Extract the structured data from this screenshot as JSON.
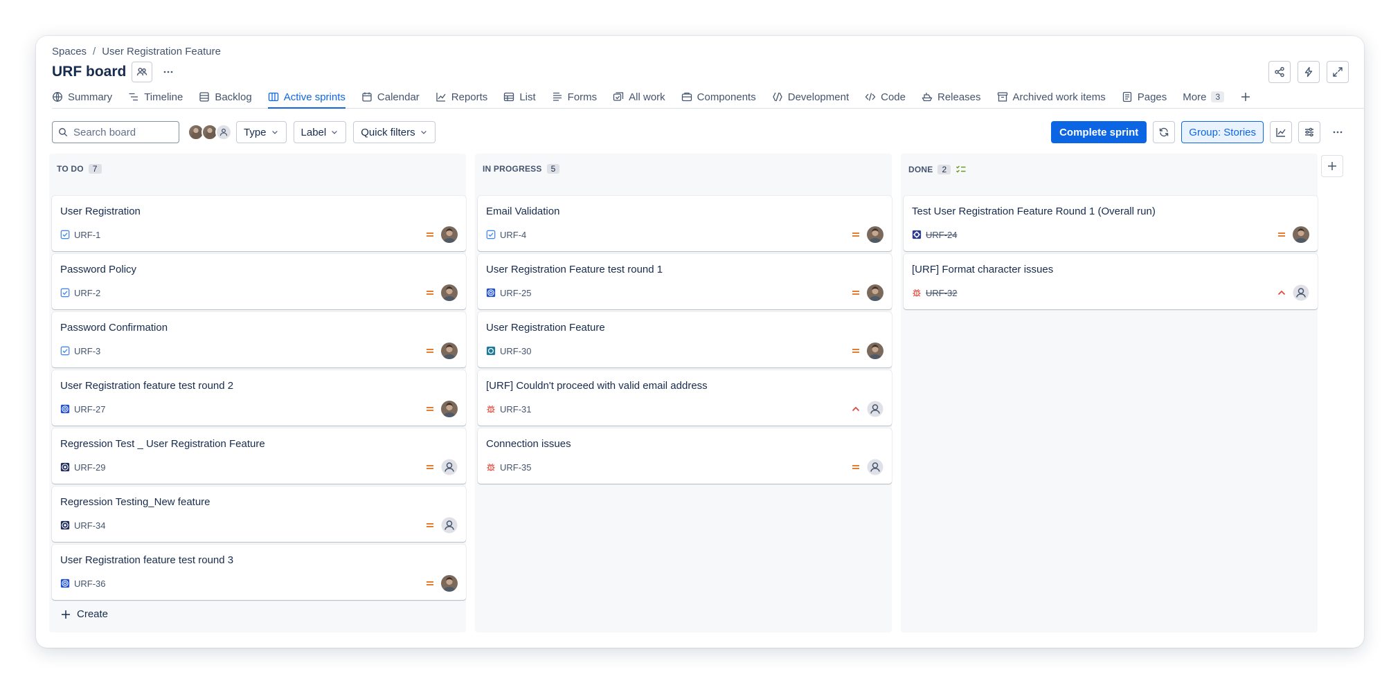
{
  "breadcrumb": {
    "root": "Spaces",
    "separator": "/",
    "project": "User Registration Feature"
  },
  "board": {
    "title": "URF board"
  },
  "tabs": [
    {
      "label": "Summary",
      "icon": "globe-icon"
    },
    {
      "label": "Timeline",
      "icon": "timeline-icon"
    },
    {
      "label": "Backlog",
      "icon": "backlog-icon"
    },
    {
      "label": "Active sprints",
      "icon": "board-icon",
      "active": true
    },
    {
      "label": "Calendar",
      "icon": "calendar-icon"
    },
    {
      "label": "Reports",
      "icon": "chart-line-icon"
    },
    {
      "label": "List",
      "icon": "table-icon"
    },
    {
      "label": "Forms",
      "icon": "forms-icon"
    },
    {
      "label": "All work",
      "icon": "all-work-icon"
    },
    {
      "label": "Components",
      "icon": "components-icon"
    },
    {
      "label": "Development",
      "icon": "branch-icon"
    },
    {
      "label": "Code",
      "icon": "code-icon"
    },
    {
      "label": "Releases",
      "icon": "ship-icon"
    },
    {
      "label": "Archived work items",
      "icon": "archive-icon"
    },
    {
      "label": "Pages",
      "icon": "page-icon"
    }
  ],
  "more_tab": {
    "label": "More",
    "count": "3"
  },
  "toolbar": {
    "search_placeholder": "Search board",
    "filters": [
      "Type",
      "Label",
      "Quick filters"
    ],
    "complete_sprint": "Complete sprint",
    "group_by": "Group: Stories"
  },
  "colors": {
    "accent": "#0c66e4",
    "priority_medium": "#e56910",
    "priority_high": "#e2483d",
    "task": "#4688ec",
    "bug": "#e2483d"
  },
  "columns": [
    {
      "name": "TO DO",
      "count": "7",
      "cards": [
        {
          "title": "User Registration",
          "key": "URF-1",
          "type": "task",
          "priority": "medium",
          "assignee": "photo"
        },
        {
          "title": "Password Policy",
          "key": "URF-2",
          "type": "task",
          "priority": "medium",
          "assignee": "photo"
        },
        {
          "title": "Password Confirmation",
          "key": "URF-3",
          "type": "task",
          "priority": "medium",
          "assignee": "photo"
        },
        {
          "title": "User Registration feature test round 2",
          "key": "URF-27",
          "type": "test",
          "priority": "medium",
          "assignee": "photo"
        },
        {
          "title": "Regression Test _ User Registration Feature",
          "key": "URF-29",
          "type": "test-dark",
          "priority": "medium",
          "assignee": "unassigned"
        },
        {
          "title": "Regression Testing_New feature",
          "key": "URF-34",
          "type": "test-dark",
          "priority": "medium",
          "assignee": "unassigned"
        },
        {
          "title": "User Registration feature test round 3",
          "key": "URF-36",
          "type": "test",
          "priority": "medium",
          "assignee": "photo"
        }
      ],
      "create_label": "Create"
    },
    {
      "name": "IN PROGRESS",
      "count": "5",
      "cards": [
        {
          "title": "Email Validation",
          "key": "URF-4",
          "type": "task",
          "priority": "medium",
          "assignee": "photo"
        },
        {
          "title": "User Registration Feature test round 1",
          "key": "URF-25",
          "type": "test",
          "priority": "medium",
          "assignee": "photo"
        },
        {
          "title": "User Registration Feature",
          "key": "URF-30",
          "type": "test-teal",
          "priority": "medium",
          "assignee": "photo"
        },
        {
          "title": "[URF] Couldn't proceed with valid email address",
          "key": "URF-31",
          "type": "bug",
          "priority": "high",
          "assignee": "unassigned"
        },
        {
          "title": "Connection issues",
          "key": "URF-35",
          "type": "bug",
          "priority": "medium",
          "assignee": "unassigned"
        }
      ]
    },
    {
      "name": "DONE",
      "count": "2",
      "cards": [
        {
          "title": "Test User Registration Feature Round 1 (Overall run)",
          "key": "URF-24",
          "type": "test-exec",
          "priority": "medium",
          "assignee": "photo",
          "done": true
        },
        {
          "title": "[URF] Format character issues",
          "key": "URF-32",
          "type": "bug",
          "priority": "high",
          "assignee": "unassigned",
          "done": true
        }
      ]
    }
  ]
}
